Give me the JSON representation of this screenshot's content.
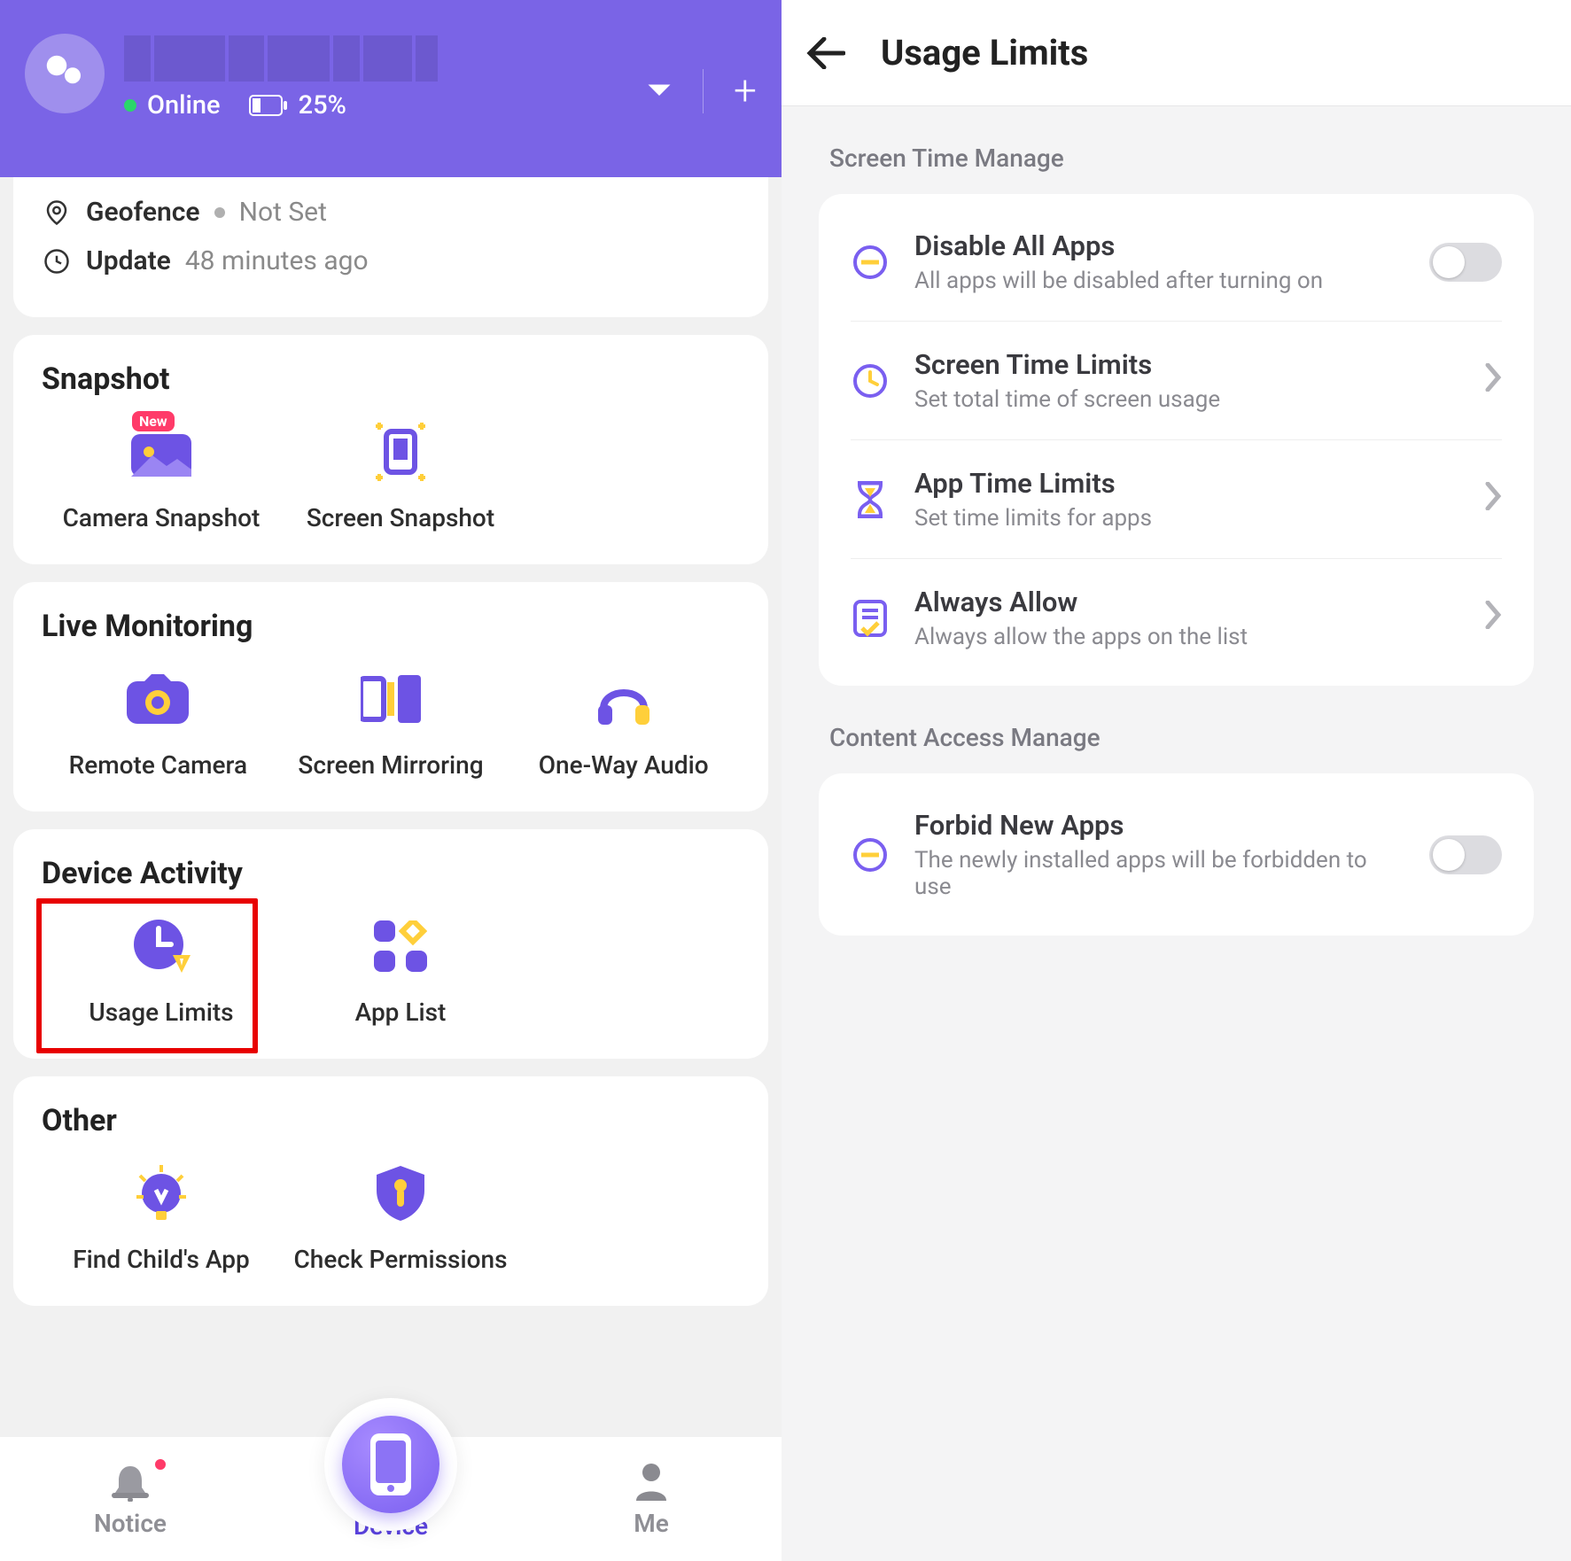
{
  "left": {
    "status_online": "Online",
    "battery_text": "25%",
    "top_rows": {
      "geofence_label": "Geofence",
      "geofence_value": "Not Set",
      "update_label": "Update",
      "update_value": "48 minutes ago"
    },
    "sections": {
      "snapshot": {
        "title": "Snapshot",
        "camera": "Camera Snapshot",
        "camera_badge": "New",
        "screen": "Screen Snapshot"
      },
      "live": {
        "title": "Live Monitoring",
        "remote": "Remote Camera",
        "mirror": "Screen Mirroring",
        "audio": "One-Way Audio"
      },
      "activity": {
        "title": "Device Activity",
        "usage": "Usage Limits",
        "applist": "App List"
      },
      "other": {
        "title": "Other",
        "find": "Find Child's App",
        "perm": "Check Permissions"
      }
    },
    "nav": {
      "notice": "Notice",
      "device": "Device",
      "me": "Me"
    }
  },
  "right": {
    "title": "Usage Limits",
    "screen_time_label": "Screen Time Manage",
    "content_access_label": "Content Access Manage",
    "items": {
      "disable": {
        "title": "Disable All Apps",
        "sub": "All apps will be disabled after turning on"
      },
      "stl": {
        "title": "Screen Time Limits",
        "sub": "Set total time of screen usage"
      },
      "atl": {
        "title": "App Time Limits",
        "sub": "Set time limits for apps"
      },
      "allow": {
        "title": "Always Allow",
        "sub": "Always allow the apps on the list"
      },
      "forbid": {
        "title": "Forbid New Apps",
        "sub": "The newly installed apps will be forbidden to use"
      }
    }
  }
}
